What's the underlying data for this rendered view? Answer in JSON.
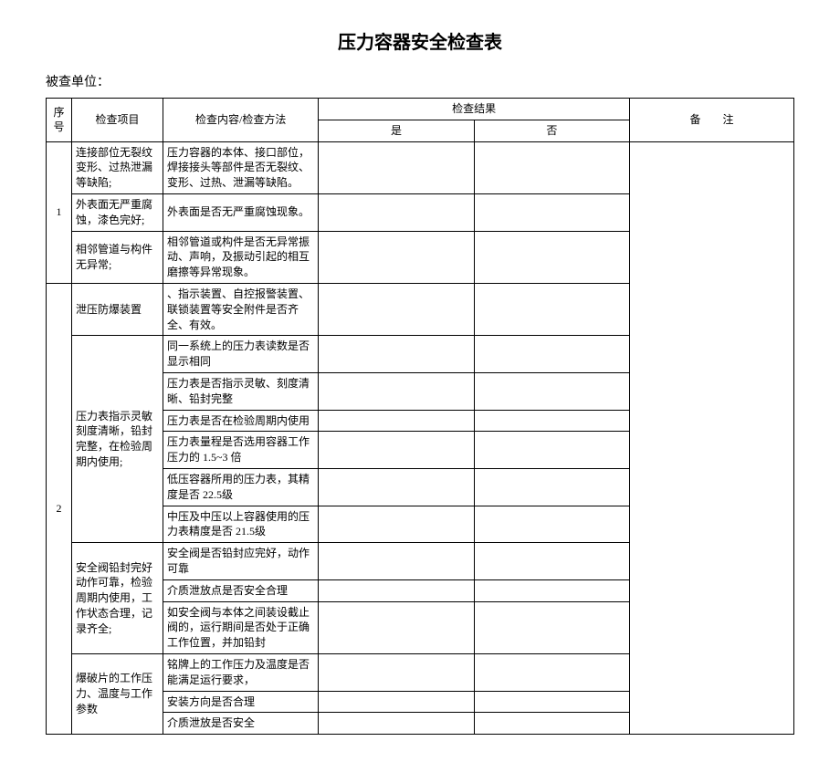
{
  "title": "压力容器安全检查表",
  "subtitle": "被查单位：",
  "header": {
    "num": "序号",
    "item": "检查项目",
    "desc": "检查内容/检查方法",
    "result": "检查结果",
    "yes": "是",
    "no": "否",
    "note": "备　　注"
  },
  "g1": {
    "num": "1",
    "r1_item": "连接部位无裂纹变形、过热泄漏等缺陷;",
    "r1_desc": "压力容器的本体、接口部位，焊接接头等部件是否无裂纹、变形、过热、泄漏等缺陷。",
    "r2_item": "外表面无严重腐蚀，漆色完好;",
    "r2_desc": "外表面是否无严重腐蚀现象。",
    "r3_item": "相邻管道与构件无异常;",
    "r3_desc": "相邻管道或构件是否无异常振动、声响，及振动引起的相互磨擦等异常现象。"
  },
  "g2": {
    "num": "2",
    "r1_item": "泄压防爆装置",
    "r1_desc": "、指示装置、自控报警装置、联锁装置等安全附件是否齐全、有效。",
    "r2_item": "压力表指示灵敏刻度清晰，铅封完整，在检验周期内使用;",
    "r2_desc": "同一系统上的压力表读数是否显示相同",
    "r3_desc": "压力表是否指示灵敏、刻度清晰、铅封完整",
    "r4_desc": "压力表是否在检验周期内使用",
    "r5_desc": "压力表量程是否选用容器工作压力的 1.5~3 倍",
    "r6_desc": "低压容器所用的压力表，其精度是否 22.5级",
    "r7_desc": "中压及中压以上容器使用的压力表精度是否 21.5级",
    "r8_item": "安全阀铅封完好动作可靠，检验周期内使用，工作状态合理，记录齐全;",
    "r8_desc": "安全阀是否铅封应完好，动作可靠",
    "r9_desc": "介质泄放点是否安全合理",
    "r10_desc": "如安全阀与本体之间装设截止阀的，运行期间是否处于正确工作位置，并加铅封",
    "r11_item": "爆破片的工作压力、温度与工作参数",
    "r11_desc": "铭牌上的工作压力及温度是否能满足运行要求，",
    "r12_desc": "安装方向是否合理",
    "r13_desc": "介质泄放是否安全"
  }
}
